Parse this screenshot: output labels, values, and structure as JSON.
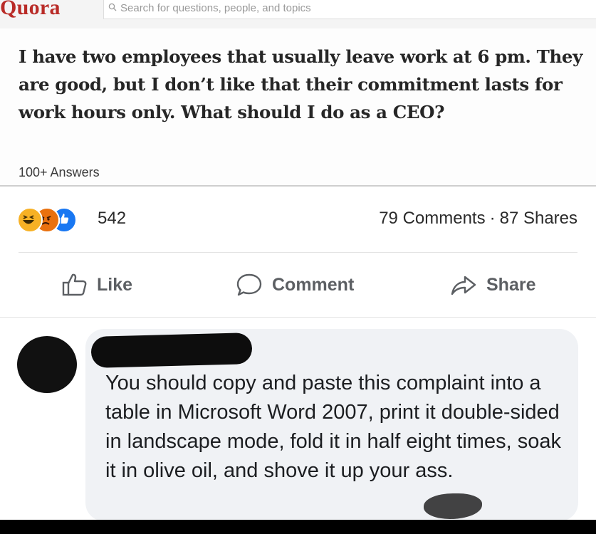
{
  "quora": {
    "logo": "Quora",
    "search_placeholder": "Search for questions, people, and topics",
    "question": "I have two employees that usually leave work at 6 pm. They are good, but I don’t like that their commitment lasts for work hours only. What should I do as a CEO?",
    "answers_count": "100+ Answers"
  },
  "post": {
    "reactions": [
      "haha-icon",
      "angry-icon",
      "like-icon"
    ],
    "reaction_count": "542",
    "comments": "79 Comments",
    "separator": "·",
    "shares": "87 Shares",
    "actions": {
      "like": "Like",
      "comment": "Comment",
      "share": "Share"
    }
  },
  "comment": {
    "text": "You should copy and paste this complaint into a table in Microsoft Word 2007, print it double-sided in landscape mode, fold it in half eight times, soak it in olive oil, and shove it up your ass."
  },
  "colors": {
    "quora_red": "#b92b27",
    "facebook_blue": "#1877f2",
    "haha_yellow": "#f7b125",
    "angry_orange": "#e9710f",
    "bubble_gray": "#f0f2f5"
  }
}
